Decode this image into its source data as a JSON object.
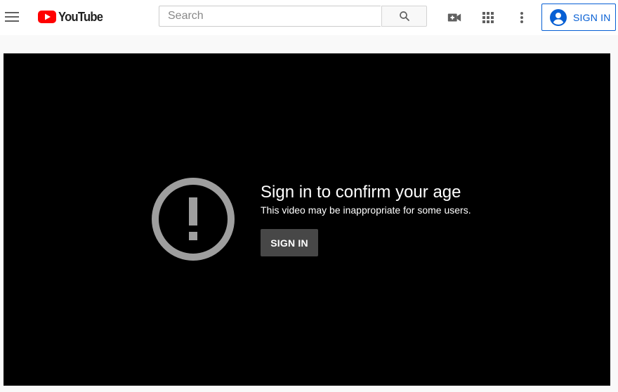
{
  "masthead": {
    "logo_text": "YouTube",
    "search": {
      "placeholder": "Search",
      "value": ""
    },
    "signin_label": "SIGN IN",
    "icons": [
      "menu-icon",
      "youtube-logo-icon",
      "search-icon",
      "create-video-icon",
      "apps-grid-icon",
      "more-vert-icon",
      "account-circle-icon"
    ],
    "colors": {
      "logo_red": "#ff0000",
      "accent_blue": "#065fd4"
    }
  },
  "player": {
    "gate": {
      "title": "Sign in to confirm your age",
      "subtitle": "This video may be inappropriate for some users.",
      "button_label": "SIGN IN",
      "icon": "alert-circle-icon"
    }
  }
}
